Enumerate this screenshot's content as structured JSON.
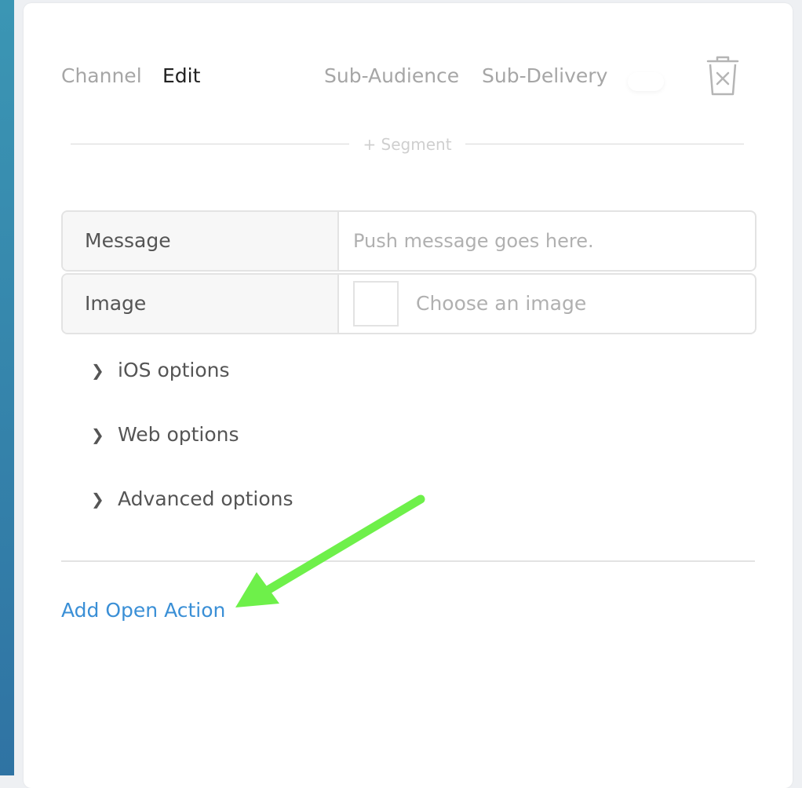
{
  "tabs": {
    "channel": "Channel",
    "edit": "Edit",
    "sub_audience": "Sub-Audience",
    "sub_delivery": "Sub-Delivery"
  },
  "icons": {
    "delete": "trash-icon",
    "expand": "chevron-right-icon",
    "annotation": "arrow-annotation"
  },
  "segment": {
    "label": "+ Segment"
  },
  "form": {
    "message": {
      "label": "Message",
      "placeholder": "Push message goes here."
    },
    "image": {
      "label": "Image",
      "choose_label": "Choose an image"
    }
  },
  "options": [
    {
      "chevron": "❯",
      "label": "iOS options"
    },
    {
      "chevron": "❯",
      "label": "Web options"
    },
    {
      "chevron": "❯",
      "label": "Advanced options"
    }
  ],
  "actions": {
    "add_open_action": "Add Open Action"
  },
  "colors": {
    "accent_link": "#3a8fd6",
    "annotation_arrow": "#6ef04a",
    "active_tab": "#222222",
    "inactive_tab": "#a6a6a6",
    "sidebar_strip": "#2f7fad"
  }
}
